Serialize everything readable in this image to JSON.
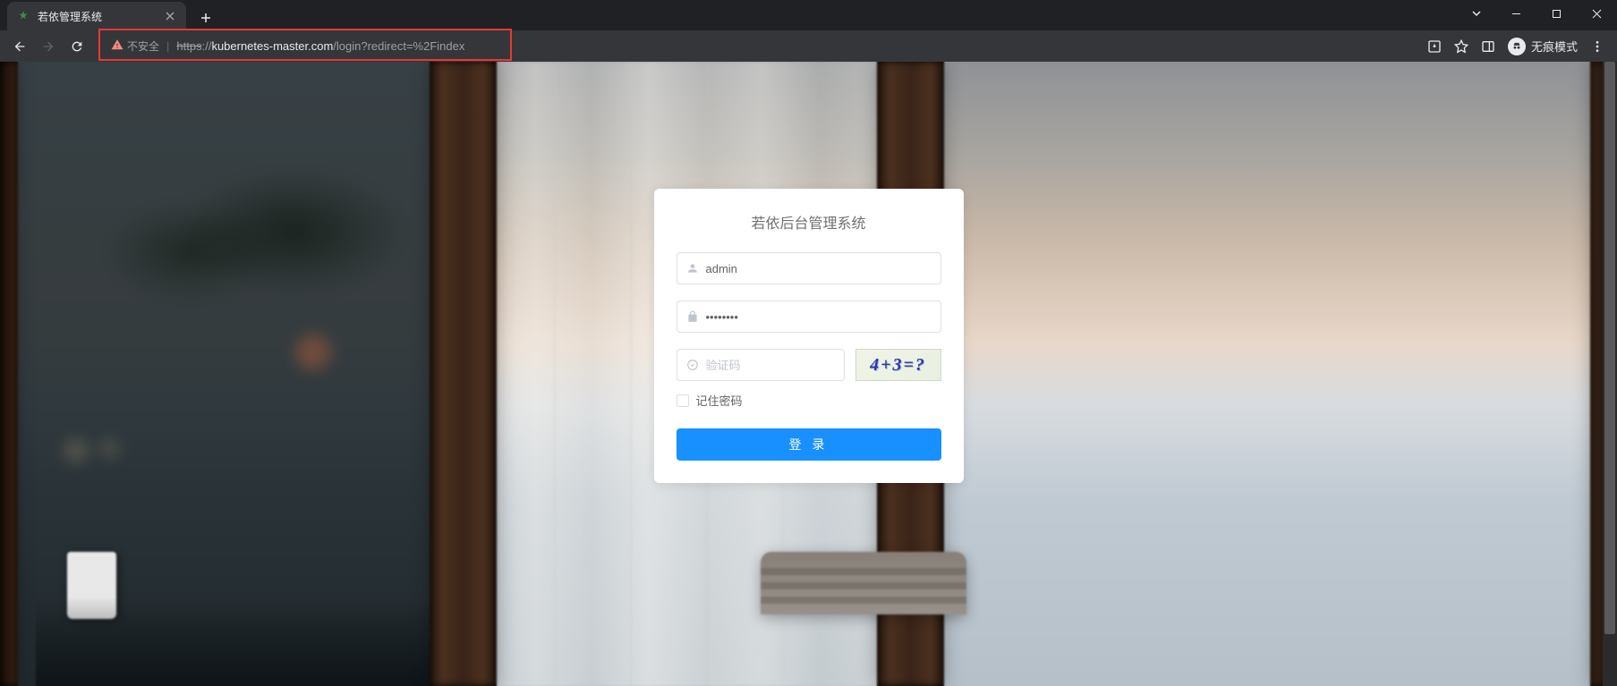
{
  "browser": {
    "tab_title": "若依管理系统",
    "security_label": "不安全",
    "url_scheme": "https",
    "url_sep": "://",
    "url_host": "kubernetes-master.com",
    "url_path": "/login?redirect=%2Findex",
    "incognito_label": "无痕模式"
  },
  "login": {
    "title": "若依后台管理系统",
    "username_value": "admin",
    "password_value": "••••••••",
    "captcha_placeholder": "验证码",
    "captcha_text": "4+3=?",
    "remember_label": "记住密码",
    "submit_label": "登 录"
  }
}
